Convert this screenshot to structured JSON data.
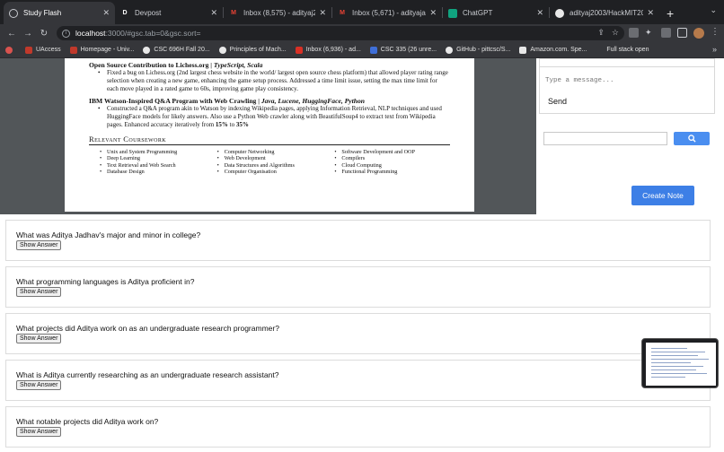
{
  "browser": {
    "tabs": [
      {
        "label": "Study Flash",
        "favicon": "globe",
        "active": true
      },
      {
        "label": "Devpost",
        "favicon": "D",
        "active": false
      },
      {
        "label": "Inbox (8,575) - adityaj200",
        "favicon": "M",
        "active": false
      },
      {
        "label": "Inbox (5,671) - adityajadh",
        "favicon": "M",
        "active": false
      },
      {
        "label": "ChatGPT",
        "favicon": "gpt",
        "active": false
      },
      {
        "label": "adityaj2003/HackMIT2023",
        "favicon": "github",
        "active": false
      }
    ],
    "url_host": "localhost",
    "url_path": ":3000/#gsc.tab=0&gsc.sort=",
    "bookmarks": [
      {
        "label": "UAccess",
        "color": "#c0392b"
      },
      {
        "label": "Homepage - Univ...",
        "color": "#c0392b"
      },
      {
        "label": "CSC 696H Fall 20...",
        "color": "#e8e8e8"
      },
      {
        "label": "Principles of Mach...",
        "color": "#e8e8e8"
      },
      {
        "label": "Inbox (6,936) - ad...",
        "color": "#d93025"
      },
      {
        "label": "CSC 335 (26 unre...",
        "color": "#3f6fd8"
      },
      {
        "label": "GitHub - pittcsc/S...",
        "color": "#e8e8e8"
      },
      {
        "label": "Amazon.com. Spe...",
        "color": "#e8e8e8"
      },
      {
        "label": "Full stack open",
        "color": "#35363a"
      }
    ],
    "more": "»"
  },
  "resume": {
    "project1_title": "Open Source Contribution to Lichess.org | ",
    "project1_tech": "TypeScript, Scala",
    "project1_bullet": "Fixed a bug on Lichess.org (2nd largest chess website in the world/ largest open source chess platform) that allowed player rating range selection when creating a new game, enhancing the game setup process. Addressed a time limit issue, setting the max time limit for each move played in a rated game to 60s, improving game play consistency.",
    "project2_title": "IBM Watson-Inspired Q&A Program with Web Crawling | ",
    "project2_tech": "Java, Lucene, HuggingFace, Python",
    "project2_bullet_a": "Constructed a Q&A program akin to Watson by indexing Wikipedia pages, applying Information Retrieval, NLP techniques and used HuggingFace models for likely answers. Also use a Python Web crawler along with BeautifulSoup4 to extract text from Wikipedia pages. Enhanced accuracy iteratively from ",
    "project2_bullet_b": "15%",
    "project2_bullet_c": " to ",
    "project2_bullet_d": "35%",
    "coursework_heading": "Relevant Coursework",
    "courses_col1": [
      "Unix and System Programming",
      "Deep Learning",
      "Text Retrieval and Web Search",
      "Database Design"
    ],
    "courses_col2": [
      "Computer Networking",
      "Web Development",
      "Data Structures and Algorithms",
      "Computer Organisation"
    ],
    "courses_col3": [
      "Software Development and OOP",
      "Compilers",
      "Cloud Computing",
      "Functional Programming"
    ]
  },
  "chat": {
    "placeholder": "Type a message...",
    "send_label": "Send"
  },
  "search": {
    "placeholder": ""
  },
  "create_note_label": "Create Note",
  "cards": [
    {
      "question": "What was Aditya Jadhav's major and minor in college?",
      "button": "Show Answer"
    },
    {
      "question": "What programming languages is Aditya proficient in?",
      "button": "Show Answer"
    },
    {
      "question": "What projects did Aditya work on as an undergraduate research programmer?",
      "button": "Show Answer"
    },
    {
      "question": "What is Aditya currently researching as an undergraduate research assistant?",
      "button": "Show Answer"
    },
    {
      "question": "What notable projects did Aditya work on?",
      "button": "Show Answer"
    }
  ]
}
